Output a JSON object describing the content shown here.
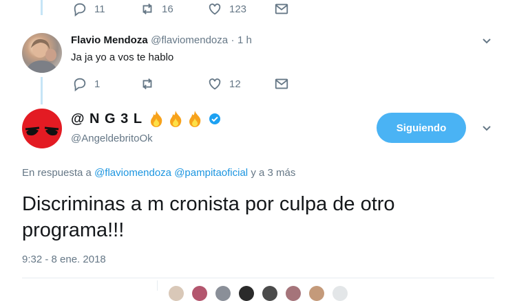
{
  "top_tweet": {
    "actions": {
      "reply_count": "11",
      "retweet_count": "16",
      "like_count": "123"
    }
  },
  "reply_tweet": {
    "author_name": "Flavio Mendoza",
    "author_handle": "@flaviomendoza",
    "separator": "·",
    "time_ago": "1 h",
    "text": "Ja ja yo a vos te hablo",
    "actions": {
      "reply_count": "1",
      "retweet_count": "",
      "like_count": "12"
    }
  },
  "main_tweet": {
    "display_name": "@ N G 3 L",
    "emoji": [
      "fire-icon",
      "fire-icon",
      "fire-icon"
    ],
    "verified": true,
    "handle": "@AngeldebritoOk",
    "follow_button": "Siguiendo",
    "in_reply_prefix": "En respuesta a",
    "reply_to_1": "@flaviomendoza",
    "reply_to_2": "@pampitaoficial",
    "reply_suffix": "y a 3 más",
    "text": "Discriminas a m cronista por culpa de otro programa!!!",
    "timestamp": "9:32 - 8 ene. 2018"
  },
  "colors": {
    "accent": "#1da1f2",
    "follow_button": "#4ab3f4",
    "muted": "#657786",
    "thread_line": "#c6e4f6"
  }
}
